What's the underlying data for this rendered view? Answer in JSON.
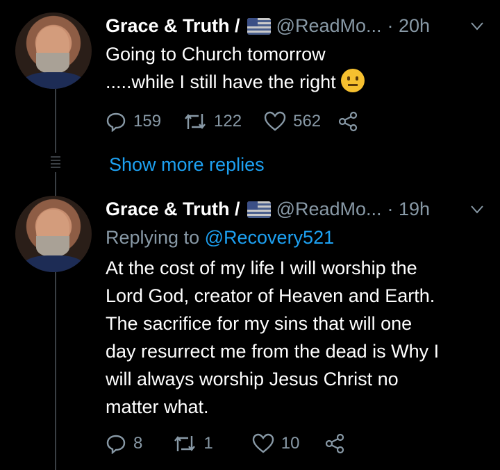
{
  "tweet1": {
    "display_name": "Grace & Truth /",
    "handle": "@ReadMo...",
    "time": "· 20h",
    "line1": "Going to Church tomorrow",
    "line2": ".....while I still have the right",
    "replies": "159",
    "retweets": "122",
    "likes": "562"
  },
  "thread": {
    "show_more": "Show more replies"
  },
  "tweet2": {
    "display_name": "Grace & Truth /",
    "handle": "@ReadMo...",
    "time": "· 19h",
    "replying_prefix": "Replying to",
    "replying_to": "@Recovery521",
    "body_lines": [
      "At the cost of my life I will worship the",
      "Lord God, creator of Heaven and Earth.",
      "The sacrifice for my sins that will one",
      "day resurrect me from the dead is Why I",
      "will always worship Jesus Christ no",
      "matter what."
    ],
    "replies": "8",
    "retweets": "1",
    "likes": "10"
  },
  "icons": [
    "flag-usa-icon",
    "neutral-face-emoji-icon",
    "chevron-down-icon",
    "reply-icon",
    "retweet-icon",
    "heart-icon",
    "share-icon"
  ],
  "colors": {
    "background": "#000000",
    "link": "#1da1f2",
    "muted": "#8899a6"
  }
}
